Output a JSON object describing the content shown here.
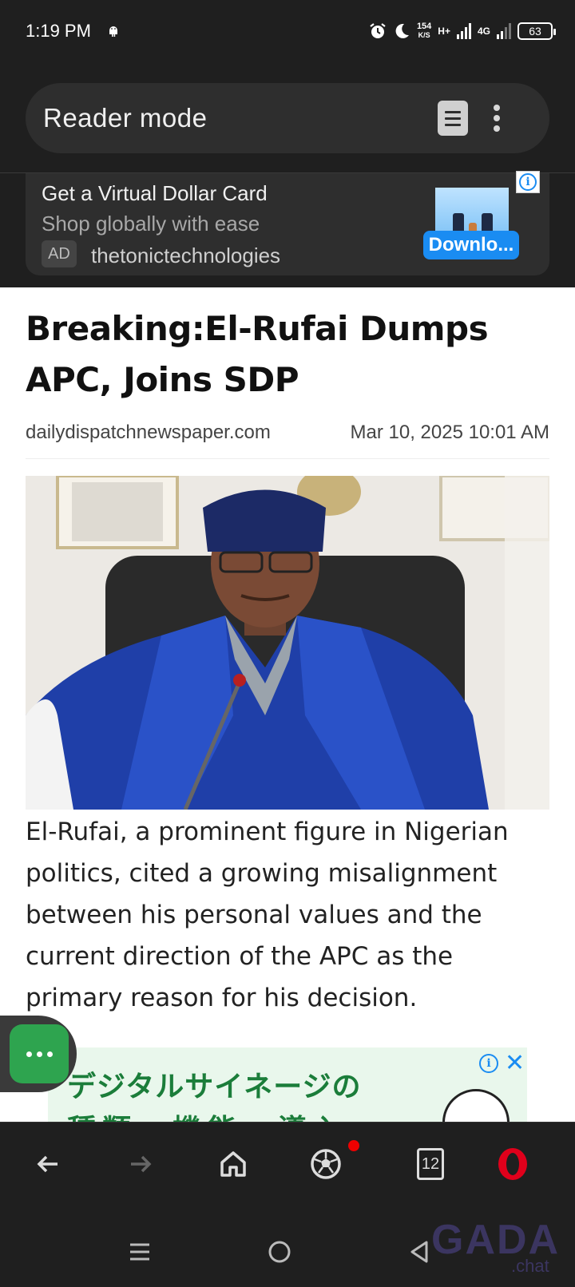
{
  "status_bar": {
    "time": "1:19 PM",
    "network_speed_value": "154",
    "network_speed_unit": "K/S",
    "network_type_1": "H+",
    "network_type_2": "4G",
    "battery": "63"
  },
  "toolbar": {
    "title": "Reader mode"
  },
  "ad_banner": {
    "title": "Get a Virtual Dollar Card",
    "subtitle": "Shop globally with ease",
    "badge": "AD",
    "advertiser": "thetonictechnologies",
    "cta": "Downlo..."
  },
  "article": {
    "headline": "Breaking:El-Rufai Dumps APC, Joins SDP",
    "source": "dailydispatchnewspaper.com",
    "date": "Mar 10, 2025 10:01 AM",
    "body": "El-Rufai, a prominent figure in Nigerian politics, cited a growing misalignment between his personal values and the current direction of the APC as the primary reason for his decision."
  },
  "ad_bottom": {
    "line1": "デジタルサイネージの",
    "line2": "種類、機能、導入"
  },
  "bottom_nav": {
    "tabs_count": "12"
  },
  "watermark": {
    "main": "GADA",
    "sub": ".chat"
  },
  "colors": {
    "background_dark": "#1f1f1f",
    "pill": "#2e2e2e",
    "accent_blue": "#1a8cf2",
    "opera_red": "#e0001b",
    "chat_green": "#2ea44f"
  }
}
